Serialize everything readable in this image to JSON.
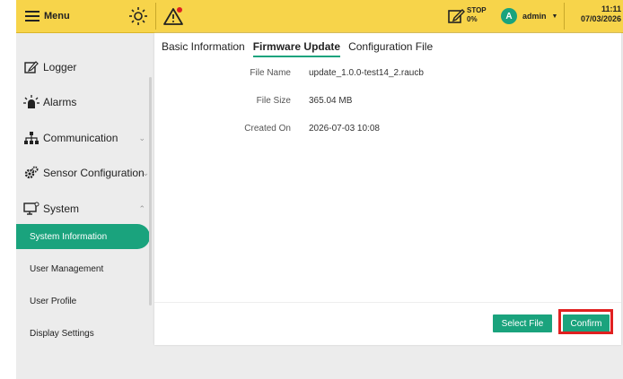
{
  "topbar": {
    "menu_label": "Menu",
    "stop_label": "STOP",
    "stop_percent": "0%",
    "user_initial": "A",
    "user_name": "admin",
    "time": "11:11",
    "date": "07/03/2026"
  },
  "sidebar": {
    "items": [
      {
        "label": "Logger",
        "icon": "edit-icon"
      },
      {
        "label": "Alarms",
        "icon": "alarm-icon"
      },
      {
        "label": "Communication",
        "icon": "network-icon"
      },
      {
        "label": "Sensor Configuration",
        "icon": "gear-icon"
      },
      {
        "label": "System",
        "icon": "monitor-icon"
      }
    ],
    "sub_items": [
      "System Information",
      "User Management",
      "User Profile",
      "Display Settings"
    ]
  },
  "tabs": [
    "Basic Information",
    "Firmware Update",
    "Configuration File"
  ],
  "file": {
    "name_label": "File Name",
    "name_value": "update_1.0.0-test14_2.raucb",
    "size_label": "File Size",
    "size_value": "365.04 MB",
    "created_label": "Created On",
    "created_value": "2026-07-03 10:08"
  },
  "buttons": {
    "select_file": "Select File",
    "confirm": "Confirm"
  },
  "colors": {
    "topbar": "#f7d44a",
    "accent": "#1aa37d",
    "highlight": "#e02020"
  }
}
